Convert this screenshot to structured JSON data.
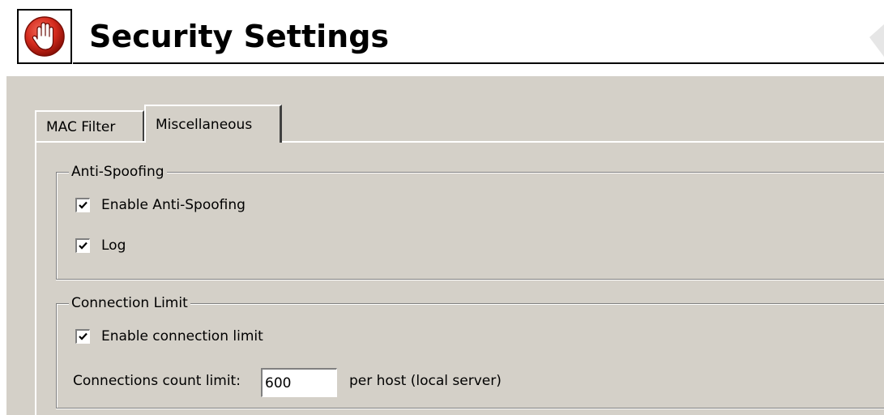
{
  "header": {
    "title": "Security Settings",
    "icon": "stop-hand-icon",
    "icon_color": "#cc1f1f"
  },
  "tabs": [
    {
      "label": "MAC Filter",
      "selected": false
    },
    {
      "label": "Miscellaneous",
      "selected": true
    }
  ],
  "anti_spoofing": {
    "legend": "Anti-Spoofing",
    "enable": {
      "label": "Enable Anti-Spoofing",
      "checked": true
    },
    "log": {
      "label": "Log",
      "checked": true
    }
  },
  "connection_limit": {
    "legend": "Connection Limit",
    "enable": {
      "label": "Enable connection limit",
      "checked": true
    },
    "count_label": "Connections count limit:",
    "count_value": "600",
    "count_suffix": "per host (local server)"
  },
  "colors": {
    "panel_bg": "#d4d0c8",
    "accent_red": "#cc1f1f"
  }
}
